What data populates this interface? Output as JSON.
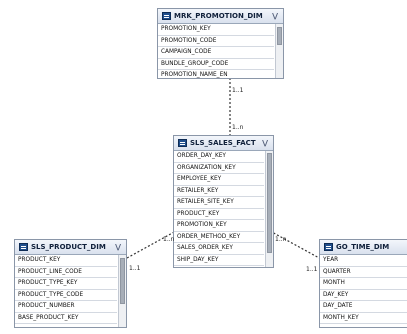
{
  "tables": {
    "promotion": {
      "title": "MRK_PROMOTION_DIM",
      "columns": [
        "PROMOTION_KEY",
        "PROMOTION_CODE",
        "CAMPAIGN_CODE",
        "BUNDLE_GROUP_CODE",
        "PROMOTION_NAME_EN"
      ]
    },
    "sales": {
      "title": "SLS_SALES_FACT",
      "columns": [
        "ORDER_DAY_KEY",
        "ORGANIZATION_KEY",
        "EMPLOYEE_KEY",
        "RETAILER_KEY",
        "RETAILER_SITE_KEY",
        "PRODUCT_KEY",
        "PROMOTION_KEY",
        "ORDER_METHOD_KEY",
        "SALES_ORDER_KEY",
        "SHIP_DAY_KEY"
      ]
    },
    "product": {
      "title": "SLS_PRODUCT_DIM",
      "columns": [
        "PRODUCT_KEY",
        "PRODUCT_LINE_CODE",
        "PRODUCT_TYPE_KEY",
        "PRODUCT_TYPE_CODE",
        "PRODUCT_NUMBER",
        "BASE_PRODUCT_KEY"
      ]
    },
    "time": {
      "title": "GO_TIME_DIM",
      "columns": [
        "YEAR",
        "QUARTER",
        "MONTH",
        "DAY_KEY",
        "DAY_DATE",
        "MONTH_KEY"
      ]
    }
  },
  "cardinalities": {
    "promotion_one": "1..1",
    "promotion_many": "1..n",
    "product_one": "1..1",
    "product_many": "1..n",
    "time_one": "1..1",
    "time_many": "1..n"
  },
  "colors": {
    "header_text": "#10203a",
    "table_icon": "#1f4e8c",
    "connector": "#333333"
  }
}
